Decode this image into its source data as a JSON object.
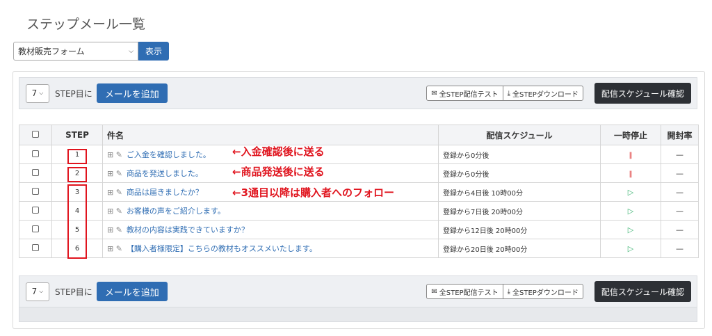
{
  "page": {
    "title": "ステップメール一覧"
  },
  "form_select": {
    "value": "教材販売フォーム",
    "show_button": "表示"
  },
  "toolbar": {
    "step_value": "7",
    "step_label": "STEP目に",
    "add_button": "メールを追加",
    "test_button": "全STEP配信テスト",
    "download_button": "全STEPダウンロード",
    "schedule_button": "配信スケジュール確認"
  },
  "table": {
    "headers": {
      "step": "STEP",
      "subject": "件名",
      "schedule": "配信スケジュール",
      "pause": "一時停止",
      "open_rate": "開封率"
    },
    "rows": [
      {
        "step": "1",
        "subject": "ご入金を確認しました。",
        "schedule": "登録から0分後",
        "pause_icon": "pause-icon",
        "open_rate": "—"
      },
      {
        "step": "2",
        "subject": "商品を発送しました。",
        "schedule": "登録から0分後",
        "pause_icon": "pause-icon",
        "open_rate": "—"
      },
      {
        "step": "3",
        "subject": "商品は届きましたか？",
        "schedule": "登録から4日後 10時00分",
        "pause_icon": "play-icon",
        "open_rate": "—"
      },
      {
        "step": "4",
        "subject": "お客様の声をご紹介します。",
        "schedule": "登録から7日後 20時00分",
        "pause_icon": "play-icon",
        "open_rate": "—"
      },
      {
        "step": "5",
        "subject": "教材の内容は実践できていますか？",
        "schedule": "登録から12日後 20時00分",
        "pause_icon": "play-icon",
        "open_rate": "—"
      },
      {
        "step": "6",
        "subject": "【購入者様限定】こちらの教材もオススメいたします。",
        "schedule": "登録から20日後 20時00分",
        "pause_icon": "play-icon",
        "open_rate": "—"
      }
    ]
  },
  "annotations": {
    "a1": "←入金確認後に送る",
    "a2": "←商品発送後に送る",
    "a3": "←3通目以降は購入者へのフォロー"
  },
  "colors": {
    "primary": "#2f6db3",
    "dark_button": "#2d3035",
    "annotation_red": "#e0141e"
  }
}
